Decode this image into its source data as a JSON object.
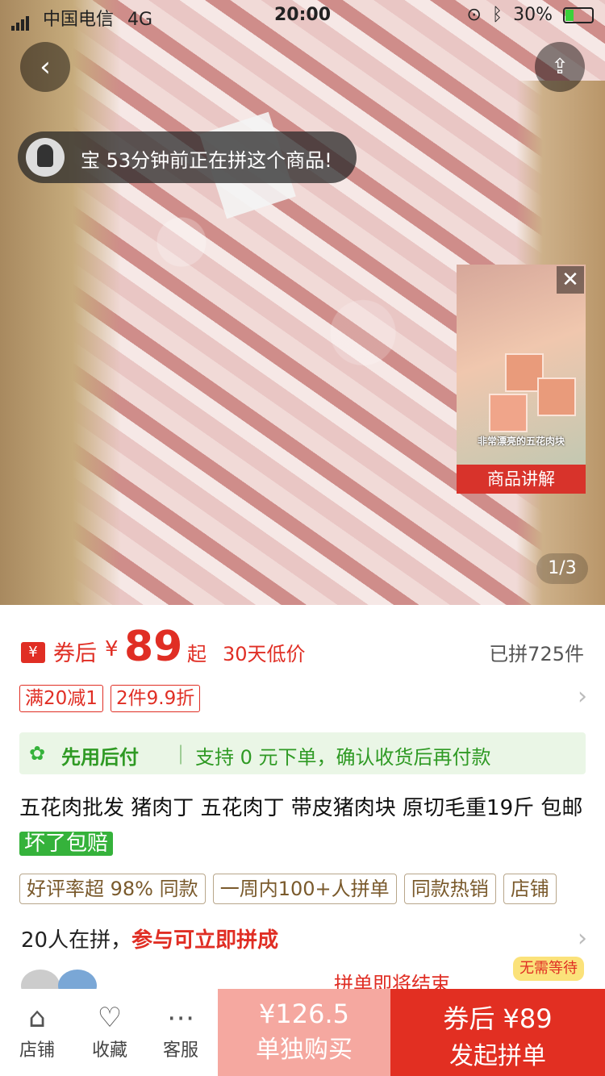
{
  "status": {
    "carrier": "中国电信",
    "network": "4G",
    "time": "20:00",
    "battery": "30%"
  },
  "hero": {
    "toast": "宝 53分钟前正在拼这个商品!",
    "video_caption": "非常漂亮的五花肉块",
    "video_label": "商品讲解",
    "pager": "1/3"
  },
  "price": {
    "coupon_label": "券后",
    "currency": "¥",
    "amount": "89",
    "suffix": "起",
    "low_price_note": "30天低价",
    "sold": "已拼725件",
    "tags": [
      "满20减1",
      "2件9.9折"
    ]
  },
  "paylater": {
    "title": "先用后付",
    "desc": "支持 0 元下单，确认收货后再付款"
  },
  "product": {
    "title": "五花肉批发 猪肉丁 五花肉丁 带皮猪肉块 原切毛重19斤 包邮",
    "badge": "坏了包赔"
  },
  "chips": [
    "好评率超 98% 同款",
    "一周内100+人拼单",
    "同款热销",
    "店铺"
  ],
  "group": {
    "count_text": "20人在拼，",
    "join_text": "参与可立即拼成",
    "ending_text": "拼单即将结束",
    "no_wait": "无需等待"
  },
  "bottom": {
    "store": "店铺",
    "favorite": "收藏",
    "service": "客服",
    "solo_price": "¥126.5",
    "solo_label": "单独购买",
    "group_price": "券后 ¥89",
    "group_label": "发起拼单"
  },
  "colors": {
    "accent": "#e02e24",
    "green": "#35b23b"
  }
}
